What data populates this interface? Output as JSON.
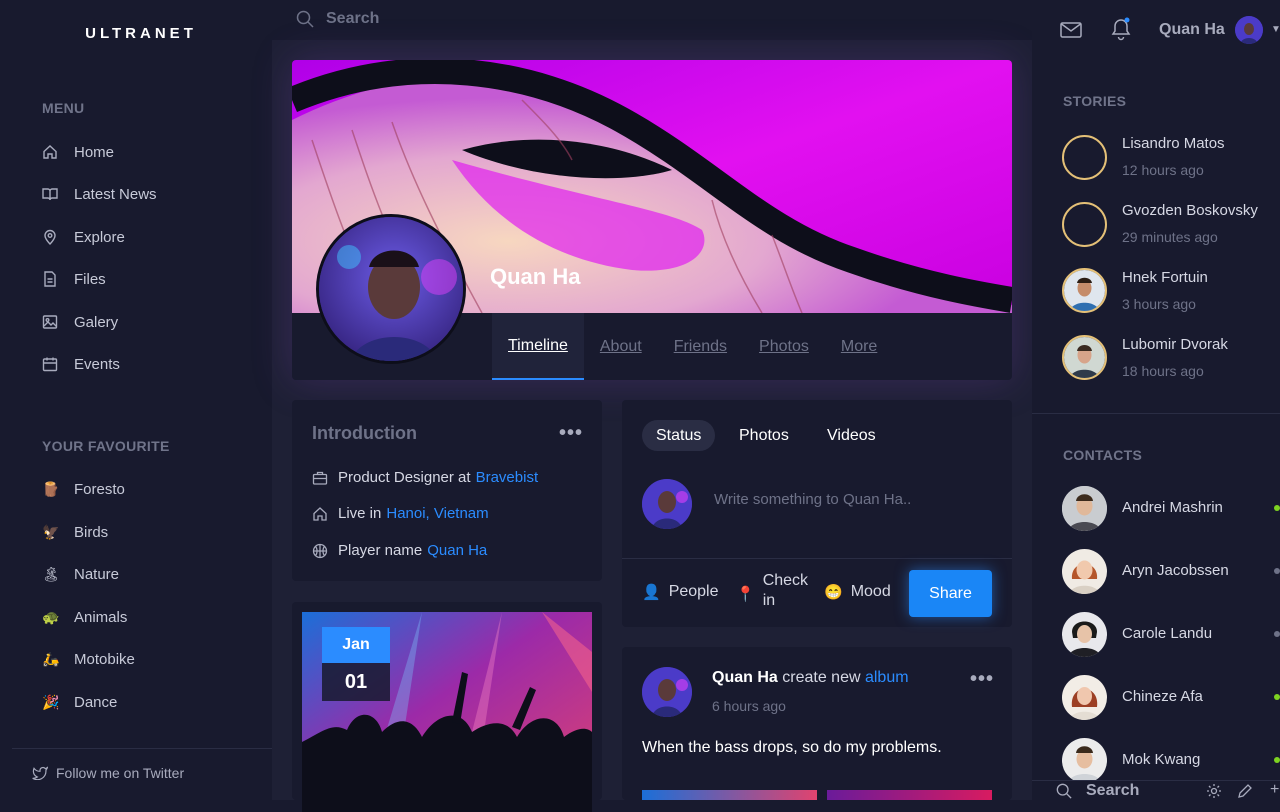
{
  "brand": "ULTRANET",
  "search": {
    "placeholder": "Search"
  },
  "sidebar": {
    "menu_title": "MENU",
    "menu": [
      {
        "label": "Home",
        "icon": "home-icon"
      },
      {
        "label": "Latest News",
        "icon": "book-icon"
      },
      {
        "label": "Explore",
        "icon": "map-pin-icon"
      },
      {
        "label": "Files",
        "icon": "file-icon"
      },
      {
        "label": "Galery",
        "icon": "image-icon"
      },
      {
        "label": "Events",
        "icon": "calendar-icon"
      }
    ],
    "fav_title": "YOUR FAVOURITE",
    "favourites": [
      {
        "label": "Foresto",
        "emoji": "🪵"
      },
      {
        "label": "Birds",
        "emoji": "🦅"
      },
      {
        "label": "Nature",
        "emoji": "🏝"
      },
      {
        "label": "Animals",
        "emoji": "🐢"
      },
      {
        "label": "Motobike",
        "emoji": "🛵"
      },
      {
        "label": "Dance",
        "emoji": "🎉"
      }
    ],
    "twitter": "Follow me on Twitter"
  },
  "profile": {
    "name": "Quan Ha",
    "tabs": [
      "Timeline",
      "About",
      "Friends",
      "Photos",
      "More"
    ]
  },
  "intro": {
    "title": "Introduction",
    "job_prefix": "Product Designer at",
    "job_link": "Bravebist",
    "live_prefix": "Live in",
    "live_link": "Hanoi, Vietnam",
    "player_prefix": "Player name",
    "player_link": "Quan Ha"
  },
  "event": {
    "month": "Jan",
    "day": "01"
  },
  "composer": {
    "tabs": [
      "Status",
      "Photos",
      "Videos"
    ],
    "placeholder": "Write something to Quan Ha..",
    "actions": {
      "people": "People",
      "checkin_1": "Check",
      "checkin_2": "in",
      "mood": "Mood"
    },
    "share": "Share"
  },
  "post": {
    "author": "Quan Ha",
    "action": "create new",
    "link": "album",
    "time": "6 hours ago",
    "text": "When the bass drops, so do my problems."
  },
  "user": {
    "name": "Quan Ha"
  },
  "stories": {
    "title": "STORIES",
    "items": [
      {
        "name": "Lisandro Matos",
        "time": "12 hours ago"
      },
      {
        "name": "Gvozden Boskovsky",
        "time": "29 minutes ago"
      },
      {
        "name": "Hnek Fortuin",
        "time": "3 hours ago"
      },
      {
        "name": "Lubomir Dvorak",
        "time": "18 hours ago"
      }
    ]
  },
  "contacts": {
    "title": "CONTACTS",
    "items": [
      {
        "name": "Andrei Mashrin",
        "status_color": "#7ed321"
      },
      {
        "name": "Aryn Jacobssen",
        "status_color": "#6e7288"
      },
      {
        "name": "Carole Landu",
        "status_color": "#6e7288"
      },
      {
        "name": "Chineze Afa",
        "status_color": "#7ed321"
      },
      {
        "name": "Mok Kwang",
        "status_color": "#7ed321"
      }
    ]
  },
  "chat_bar": {
    "search": "Search"
  },
  "colors": {
    "accent": "#2b8cff",
    "background": "#181a2e",
    "online": "#7ed321",
    "story_ring": "#e4c077"
  }
}
